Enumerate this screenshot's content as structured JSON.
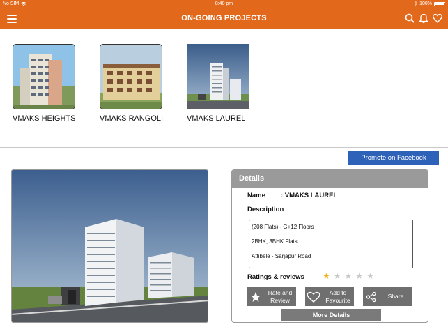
{
  "status_bar": {
    "carrier": "No SIM",
    "time": "8:40 pm",
    "battery": "100%"
  },
  "navbar": {
    "title": "ON-GOING PROJECTS",
    "icons": [
      "menu-icon",
      "search-icon",
      "bell-icon",
      "heart-icon"
    ]
  },
  "projects": [
    {
      "label": "VMAKS HEIGHTS"
    },
    {
      "label": "VMAKS RANGOLI"
    },
    {
      "label": "VMAKS LAUREL"
    }
  ],
  "facebook": {
    "label": "Promote on Facebook"
  },
  "details": {
    "header": "Details",
    "name_label": "Name",
    "name_value": ": VMAKS LAUREL",
    "description_label": "Description",
    "description_lines": [
      "(208 Flats) - G+12 Floors",
      "2BHK, 3BHK Flats",
      "Attibele - Sarjapur Road"
    ],
    "ratings_label": "Ratings & reviews",
    "rating_value": 1,
    "rating_max": 5,
    "actions": {
      "rate": "Rate and Review",
      "favourite": "Add to Favourite",
      "share": "Share"
    },
    "more_label": "More Details"
  },
  "colors": {
    "brand": "#e2691b",
    "facebook": "#2e61b8",
    "panel_header": "#9a9a9a",
    "button": "#6f6f6f",
    "star_on": "#f2b227",
    "star_off": "#c9c9c9"
  }
}
